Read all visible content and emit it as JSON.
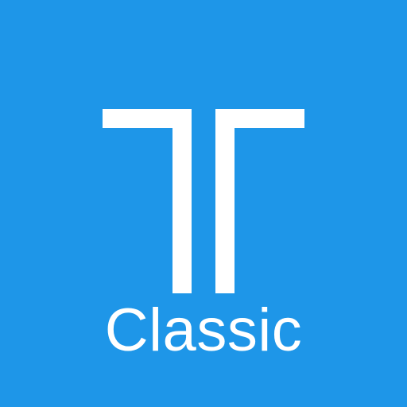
{
  "icon": {
    "label": "Classic",
    "mark": "double-t-logo-icon",
    "background_color": "#1E96E8",
    "foreground_color": "#FFFFFF"
  }
}
